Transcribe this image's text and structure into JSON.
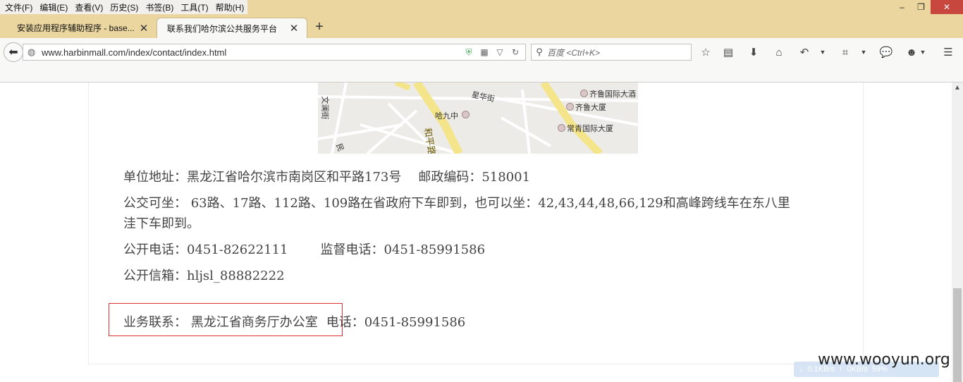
{
  "menu": [
    "文件(F)",
    "编辑(E)",
    "查看(V)",
    "历史(S)",
    "书签(B)",
    "工具(T)",
    "帮助(H)"
  ],
  "window_controls": {
    "minimize": "–",
    "restore": "❐",
    "close": "✕"
  },
  "tabs": [
    {
      "title": "安装应用程序辅助程序 - base...",
      "active": false
    },
    {
      "title": "联系我们哈尔滨公共服务平台",
      "active": true
    }
  ],
  "new_tab_label": "+",
  "urlbar": {
    "url": "www.harbinmall.com/index/contact/index.html"
  },
  "search": {
    "placeholder": "百度 <Ctrl+K>"
  },
  "map_labels": {
    "street1": "星华街",
    "street2": "文澜街",
    "poi1": "齐鲁国际大酒",
    "poi2": "齐鲁大厦",
    "poi3": "常青国际大厦",
    "school": "哈九中",
    "road": "和平路",
    "street3": "民"
  },
  "contact": {
    "address": "单位地址：黑龙江省哈尔滨市南岗区和平路173号",
    "postcode": "邮政编码：518001",
    "bus_line1": "公交可坐： 63路、17路、112路、109路在省政府下车即到，也可以坐：42,43,44,48,66,129和高峰跨线车在东八里",
    "bus_line2": "洼下车即到。",
    "public_phone": "公开电话：0451-82622111",
    "supervision_phone": "监督电话：0451-85991586",
    "public_mailbox": "公开信箱：hljsl_88882222",
    "business_contact": "业务联系： 黑龙江省商务厅办公室",
    "business_phone": "电话：0451-85991586"
  },
  "net_status": {
    "down": "0.1KB/s",
    "up": "0KB/s",
    "percent": "59%"
  },
  "watermark": "www.wooyun.org",
  "colors": {
    "chrome": "#ebd69f",
    "highlight_border": "#dd3333",
    "close_button": "#c7463d"
  }
}
